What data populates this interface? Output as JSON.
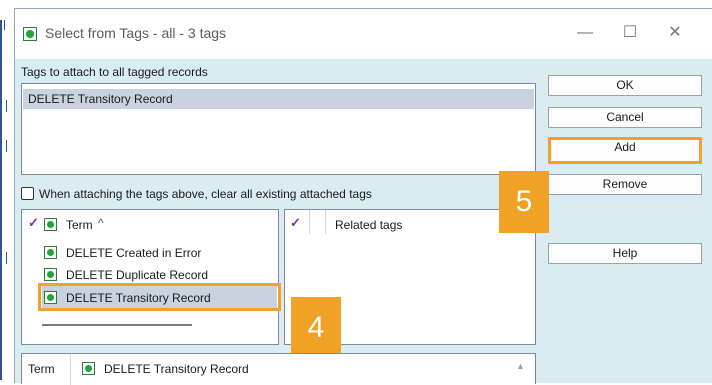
{
  "window": {
    "title": "Select from Tags - all - 3 tags",
    "minimize_glyph": "—",
    "maximize_glyph": "☐",
    "close_glyph": "✕"
  },
  "attach_section": {
    "label": "Tags to attach to all tagged records",
    "items": [
      "DELETE Transitory Record"
    ]
  },
  "clear_option": {
    "label": "When attaching the tags above, clear all existing attached tags",
    "checked": false
  },
  "buttons": {
    "ok": "OK",
    "cancel": "Cancel",
    "add": "Add",
    "remove": "Remove",
    "help": "Help"
  },
  "term_list": {
    "check_glyph": "✓",
    "header": "Term",
    "sort_glyph": "^",
    "items": [
      "DELETE Created in Error",
      "DELETE Duplicate Record",
      "DELETE Transitory Record"
    ],
    "selected_index": 2
  },
  "related": {
    "check_glyph": "✓",
    "header": "Related tags"
  },
  "bottom_bar": {
    "label": "Term",
    "value": "DELETE Transitory Record",
    "scroll_glyph": "▲"
  },
  "callouts": [
    "4",
    "5"
  ],
  "colors": {
    "highlight": "#f0a226",
    "dialog_bg": "#d8ecf1",
    "selection": "#c9d3e0",
    "check": "#7b2fb5"
  }
}
